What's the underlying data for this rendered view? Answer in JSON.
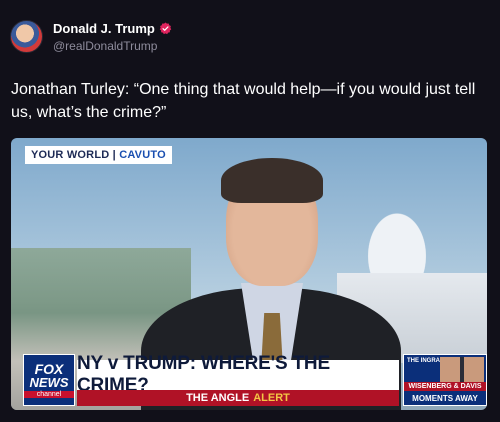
{
  "post": {
    "display_name": "Donald J. Trump",
    "handle": "@realDonaldTrump",
    "verified_icon": "verified-badge-icon",
    "accent_color": "#e0245e",
    "text": "Jonathan Turley: “One thing that would help—if you would just tell us, what’s the crime?”"
  },
  "video": {
    "show_logo_left": "YOUR WORLD",
    "show_logo_right": "CAVUTO",
    "network_logo_line1": "FOX",
    "network_logo_line2": "NEWS",
    "network_logo_line3": "channel",
    "headline": "NY v TRUMP: WHERE'S THE CRIME?",
    "subline_prefix": "THE ANGLE",
    "subline_alert": "ALERT",
    "promo_show": "THE INGRAHAM ANGLE",
    "promo_names": "WISENBERG & DAVIS",
    "promo_moments": "MOMENTS AWAY"
  }
}
